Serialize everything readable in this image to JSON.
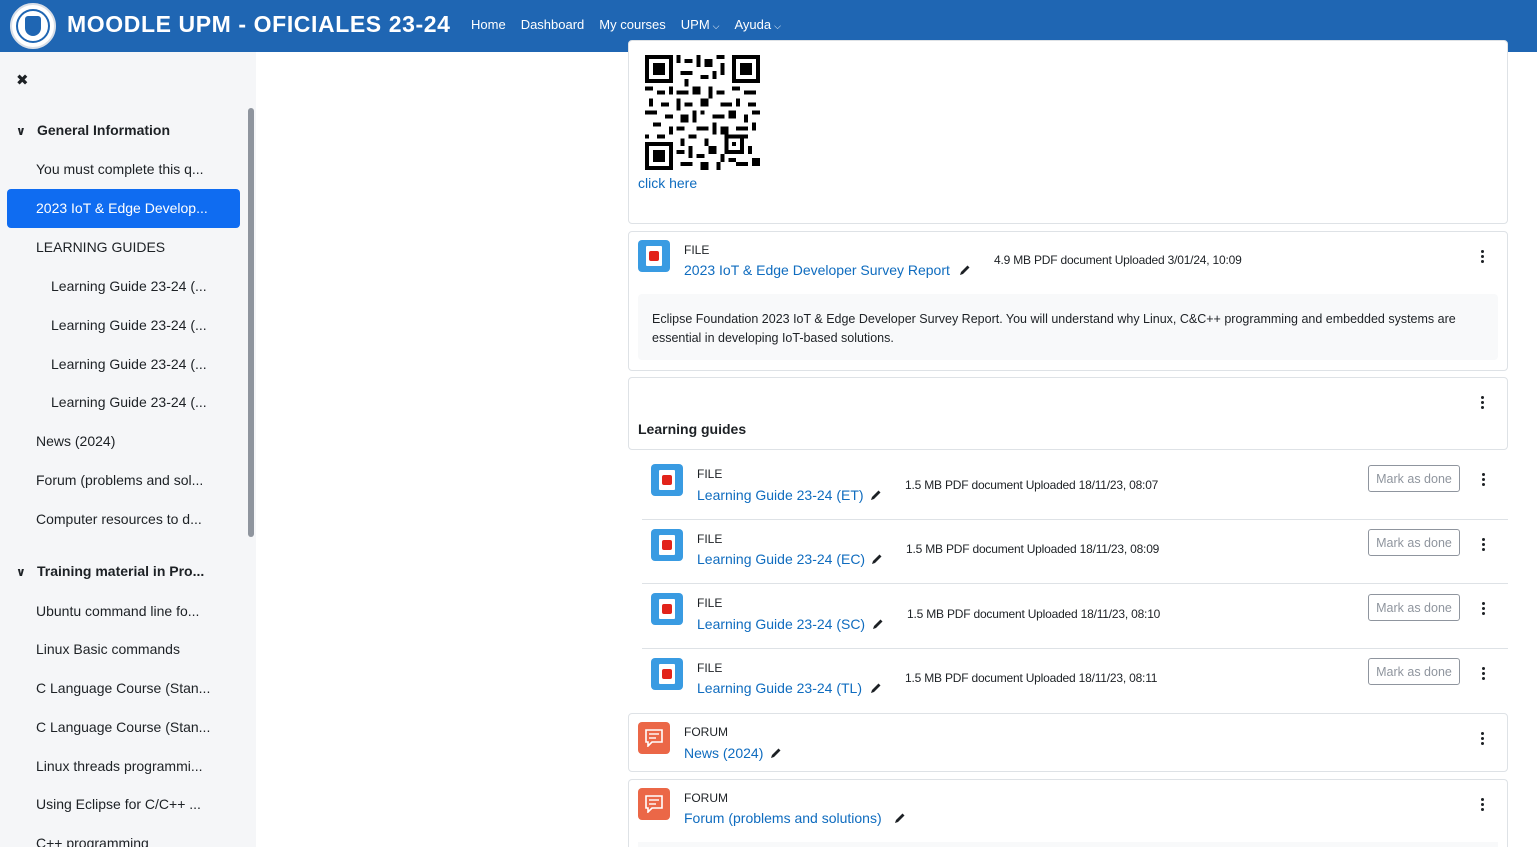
{
  "header": {
    "site_title": "MOODLE UPM - OFICIALES 23-24",
    "nav": [
      {
        "label": "Home"
      },
      {
        "label": "Dashboard"
      },
      {
        "label": "My courses"
      },
      {
        "label": "UPM"
      },
      {
        "label": "Ayuda"
      }
    ]
  },
  "drawer": {
    "sections": [
      {
        "title": "General Information"
      },
      {
        "title": "Training material in Pro..."
      }
    ],
    "items": [
      {
        "label": "You must complete this q..."
      },
      {
        "label": "2023 IoT & Edge Develop..."
      },
      {
        "label": "LEARNING GUIDES"
      },
      {
        "label": "Learning Guide 23-24 (..."
      },
      {
        "label": "Learning Guide 23-24 (..."
      },
      {
        "label": "Learning Guide 23-24 (..."
      },
      {
        "label": "Learning Guide 23-24 (..."
      },
      {
        "label": "News (2024)"
      },
      {
        "label": "Forum (problems and sol..."
      },
      {
        "label": "Computer resources to d..."
      },
      {
        "label": "Ubuntu command line fo..."
      },
      {
        "label": "Linux Basic commands"
      },
      {
        "label": "C Language Course (Stan..."
      },
      {
        "label": "C Language Course (Stan..."
      },
      {
        "label": "Linux threads programmi..."
      },
      {
        "label": "Using Eclipse for C/C++ ..."
      },
      {
        "label": "C++ programming"
      }
    ]
  },
  "main": {
    "click_here": "click here",
    "survey": {
      "type": "FILE",
      "title": "2023 IoT & Edge Developer Survey Report",
      "meta": "4.9 MB PDF document Uploaded 3/01/24, 10:09",
      "description": "Eclipse Foundation 2023 IoT & Edge Developer Survey Report. You will understand why Linux, C&C++ programming and embedded systems are essential in developing IoT-based solutions."
    },
    "section_title": "Learning guides",
    "guides": [
      {
        "type": "FILE",
        "title": "Learning Guide 23-24 (ET)",
        "meta": "1.5 MB PDF document Uploaded 18/11/23, 08:07",
        "button": "Mark as done"
      },
      {
        "type": "FILE",
        "title": "Learning Guide 23-24 (EC)",
        "meta": "1.5 MB PDF document Uploaded 18/11/23, 08:09",
        "button": "Mark as done"
      },
      {
        "type": "FILE",
        "title": "Learning Guide 23-24 (SC)",
        "meta": "1.5 MB PDF document Uploaded 18/11/23, 08:10",
        "button": "Mark as done"
      },
      {
        "type": "FILE",
        "title": "Learning Guide 23-24 (TL)",
        "meta": "1.5 MB PDF document Uploaded 18/11/23, 08:11",
        "button": "Mark as done"
      }
    ],
    "forums": [
      {
        "type": "FORUM",
        "title": "News (2024)"
      },
      {
        "type": "FORUM",
        "title": "Forum (problems and solutions)"
      }
    ]
  },
  "colors": {
    "navbar": "#1f66b3",
    "link": "#0f6cbf",
    "active_item": "#0f6cf1",
    "pdf_icon": "#399be2",
    "forum_icon": "#eb6747"
  }
}
